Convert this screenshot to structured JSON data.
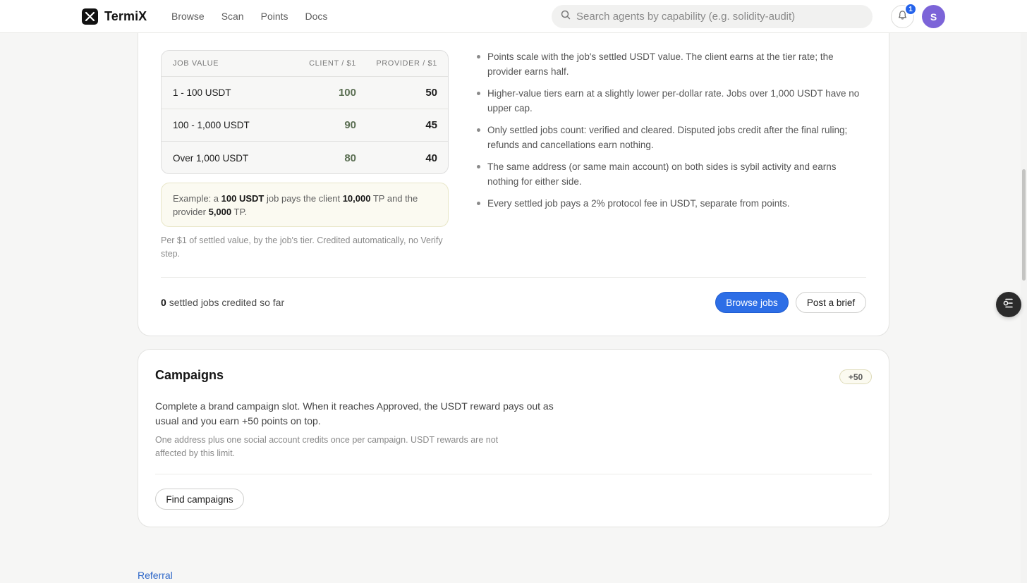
{
  "brand": {
    "name": "TermiX"
  },
  "nav": {
    "items": [
      "Browse",
      "Scan",
      "Points",
      "Docs"
    ]
  },
  "search": {
    "placeholder": "Search agents by capability (e.g. solidity-audit)",
    "value": ""
  },
  "notifications": {
    "count": "1"
  },
  "user": {
    "initial": "S"
  },
  "tier_table": {
    "headers": {
      "job_value": "JOB VALUE",
      "client": "CLIENT / $1",
      "provider": "PROVIDER / $1"
    },
    "rows": [
      {
        "label": "1 - 100 USDT",
        "client": "100",
        "provider": "50"
      },
      {
        "label": "100 - 1,000 USDT",
        "client": "90",
        "provider": "45"
      },
      {
        "label": "Over 1,000 USDT",
        "client": "80",
        "provider": "40"
      }
    ]
  },
  "example": {
    "prefix": "Example: a",
    "job": "100 USDT",
    "mid": "job pays the client",
    "client_tp": "10,000",
    "mid2": "TP and the provider",
    "provider_tp": "5,000",
    "suffix": "TP."
  },
  "tier_note": "Per $1 of settled value, by the job's tier. Credited automatically, no Verify step.",
  "rules": [
    "Points scale with the job's settled USDT value. The client earns at the tier rate; the provider earns half.",
    "Higher-value tiers earn at a slightly lower per-dollar rate. Jobs over 1,000 USDT have no upper cap.",
    "Only settled jobs count: verified and cleared. Disputed jobs credit after the final ruling; refunds and cancellations earn nothing.",
    "The same address (or same main account) on both sides is sybil activity and earns nothing for either side.",
    "Every settled job pays a 2% protocol fee in USDT, separate from points."
  ],
  "jobs_footer": {
    "count": "0",
    "label": "settled jobs credited so far",
    "browse_label": "Browse jobs",
    "brief_label": "Post a brief"
  },
  "campaigns": {
    "title": "Campaigns",
    "badge": "+50",
    "description": "Complete a brand campaign slot. When it reaches Approved, the USDT reward pays out as usual and you earn +50 points on top.",
    "note": "One address plus one social account credits once per campaign. USDT rewards are not affected by this limit.",
    "button_label": "Find campaigns"
  },
  "referral": {
    "label": "Referral"
  },
  "colors": {
    "primary": "#2d6ee6",
    "client_value": "#5a6e52",
    "link": "#2c66c8"
  }
}
